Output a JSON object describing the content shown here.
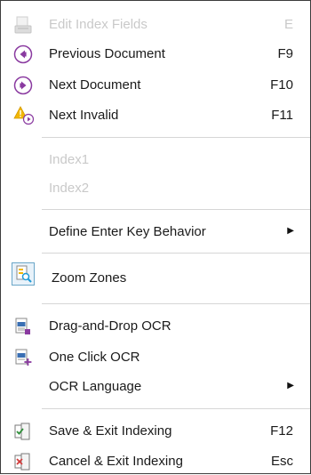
{
  "menu": {
    "items": [
      {
        "label": "Edit Index Fields",
        "key": "E"
      },
      {
        "label": "Previous Document",
        "key": "F9"
      },
      {
        "label": "Next Document",
        "key": "F10"
      },
      {
        "label": "Next Invalid",
        "key": "F11"
      },
      {
        "label": "Index1"
      },
      {
        "label": "Index2"
      },
      {
        "label": "Define Enter Key Behavior"
      },
      {
        "label": "Zoom Zones"
      },
      {
        "label": "Drag-and-Drop OCR"
      },
      {
        "label": "One Click OCR"
      },
      {
        "label": "OCR Language"
      },
      {
        "label": "Save & Exit Indexing",
        "key": "F12"
      },
      {
        "label": "Cancel & Exit Indexing",
        "key": "Esc"
      }
    ]
  },
  "colors": {
    "accent": "#1e9ad6",
    "purple": "#8a3aa0",
    "warning": "#f2b705",
    "disabled_text": "#c9c9c9"
  }
}
